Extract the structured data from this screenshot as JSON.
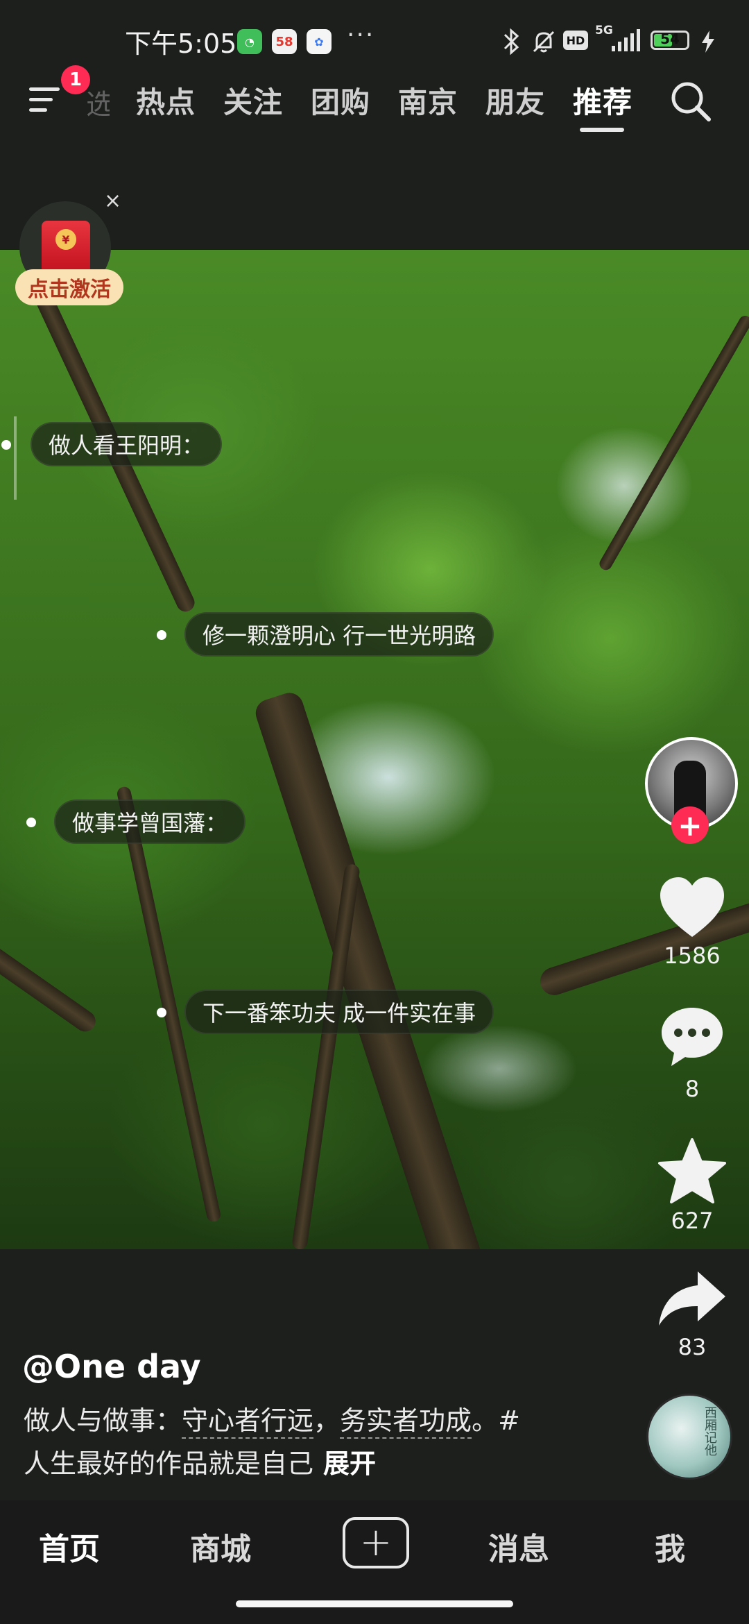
{
  "status_bar": {
    "time": "下午5:05",
    "more": "···",
    "network": "5G",
    "battery": "54",
    "battery_level": 0.54
  },
  "top_nav": {
    "partial_tab": "选",
    "tabs": [
      "热点",
      "关注",
      "团购",
      "南京",
      "朋友",
      "推荐"
    ],
    "active_tab": "推荐",
    "menu_badge": "1"
  },
  "redpack": {
    "label": "点击激活",
    "close": "×"
  },
  "captions": [
    "做人看王阳明：",
    "修一颗澄明心   行一世光明路",
    "做事学曾国藩：",
    "下一番笨功夫   成一件实在事"
  ],
  "actions": {
    "likes": "1586",
    "comments": "8",
    "favorites": "627",
    "shares": "83",
    "follow": "+"
  },
  "post": {
    "author": "@One day",
    "desc_prefix": "做人与做事：",
    "desc_tag1": "守心者行远",
    "desc_sep": "，",
    "desc_tag2": "务实者功成",
    "desc_suffix": "。#",
    "desc_line2": "人生最好的作品就是自己",
    "expand": "展开"
  },
  "music_disc_text": "西厢记他",
  "bottom_nav": {
    "home": "首页",
    "mall": "商城",
    "add": "+",
    "messages": "消息",
    "me": "我"
  },
  "colors": {
    "accent_red": "#fe2c55",
    "background": "#1c1f1c"
  }
}
